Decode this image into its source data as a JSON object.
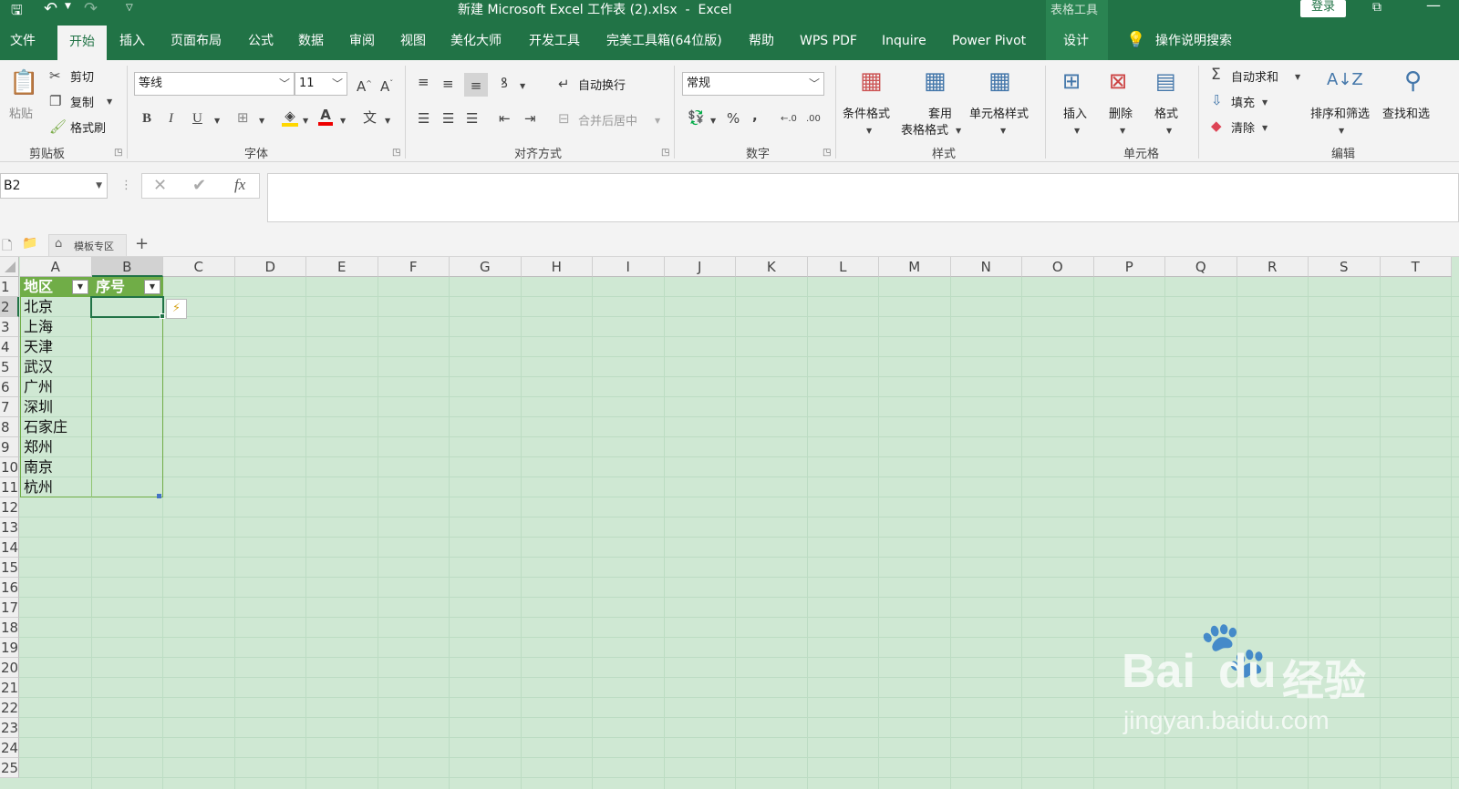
{
  "titlebar": {
    "doc_title": "新建 Microsoft Excel 工作表 (2).xlsx  -  Excel",
    "context_tools": "表格工具",
    "login": "登录"
  },
  "tabs": [
    "文件",
    "开始",
    "插入",
    "页面布局",
    "公式",
    "数据",
    "审阅",
    "视图",
    "美化大师",
    "开发工具",
    "完美工具箱(64位版)",
    "帮助",
    "WPS PDF",
    "Inquire",
    "Power Pivot",
    "设计"
  ],
  "tell_me": "操作说明搜索",
  "ribbon": {
    "clipboard": {
      "paste": "粘贴",
      "cut": "剪切",
      "copy": "复制",
      "format_painter": "格式刷",
      "label": "剪贴板"
    },
    "font": {
      "name": "等线",
      "size": "11",
      "bold": "B",
      "italic": "I",
      "underline": "U",
      "label": "字体"
    },
    "align": {
      "wrap": "自动换行",
      "merge": "合并后居中",
      "label": "对齐方式"
    },
    "number": {
      "format": "常规",
      "percent": "%",
      "comma": ",",
      "label": "数字"
    },
    "styles": {
      "cond": "条件格式",
      "table_fmt_1": "套用",
      "table_fmt_2": "表格格式",
      "cell_styles": "单元格样式",
      "label": "样式"
    },
    "cells": {
      "insert": "插入",
      "delete": "删除",
      "format": "格式",
      "label": "单元格"
    },
    "editing": {
      "autosum": "自动求和",
      "fill": "填充",
      "clear": "清除",
      "sort": "排序和筛选",
      "find": "查找和选",
      "label": "编辑"
    }
  },
  "formula": {
    "name_box": "B2",
    "fx": "fx",
    "value": ""
  },
  "sheets_bar": {
    "template": "模板专区",
    "add": "+"
  },
  "grid": {
    "columns": [
      "A",
      "B",
      "C",
      "D",
      "E",
      "F",
      "G",
      "H",
      "I",
      "J",
      "K",
      "L",
      "M",
      "N",
      "O",
      "P",
      "Q",
      "R",
      "S",
      "T"
    ],
    "rows": [
      "1",
      "2",
      "3",
      "4",
      "5",
      "6",
      "7",
      "8",
      "9",
      "10",
      "11",
      "12",
      "13",
      "14",
      "15",
      "16",
      "17",
      "18",
      "19",
      "20",
      "21",
      "22",
      "23",
      "24",
      "25"
    ],
    "header_a": "地区",
    "header_b": "序号",
    "cities": [
      "北京",
      "上海",
      "天津",
      "武汉",
      "广州",
      "深圳",
      "石家庄",
      "郑州",
      "南京",
      "杭州"
    ]
  },
  "watermark": {
    "brand": "Bai",
    "brand2": "du",
    "cn": "经验",
    "url": "jingyan.baidu.com"
  },
  "colors": {
    "excel_green": "#217346",
    "sheet_bg": "#cfe8d3",
    "table_header": "#70ad47"
  }
}
